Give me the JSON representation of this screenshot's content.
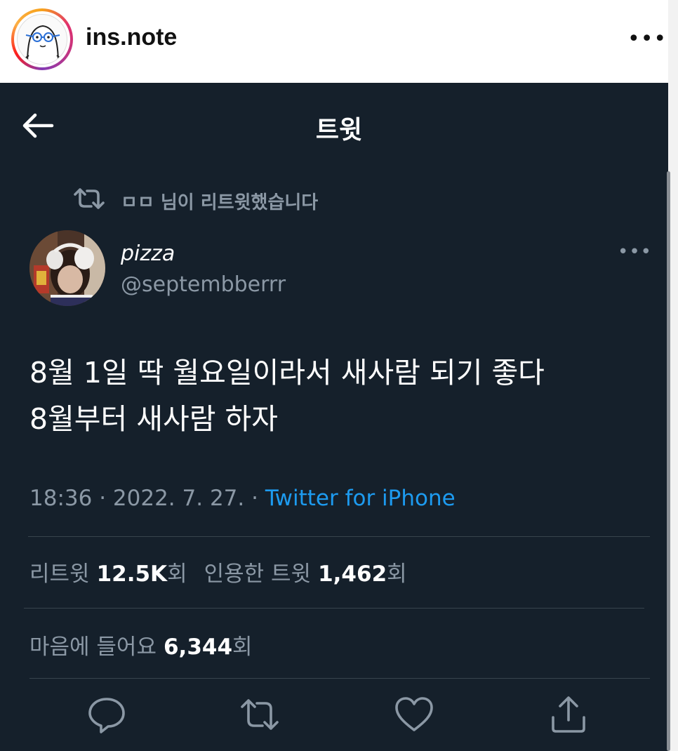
{
  "instagram_header": {
    "username": "ins.note",
    "more_label": "•••"
  },
  "twitter": {
    "page_title": "트윗",
    "retweet_notice": "ㅁㅁ 님이 리트윗했습니다",
    "author": {
      "display_name": "pizza",
      "handle": "@septembberrr"
    },
    "tweet_more_label": "•••",
    "tweet_lines": [
      "8월 1일 딱 월요일이라서 새사람 되기 좋다",
      "8월부터 새사람 하자"
    ],
    "meta": {
      "time": "18:36",
      "separator1": " · ",
      "date": "2022. 7. 27.",
      "separator2": " · ",
      "source": "Twitter for iPhone"
    },
    "stats": {
      "retweets_label": "리트윗",
      "retweets_count": "12.5K",
      "retweets_unit": "회",
      "quotes_label": "인용한 트윗",
      "quotes_count": "1,462",
      "quotes_unit": "회",
      "likes_label": "마음에 들어요",
      "likes_count": "6,344",
      "likes_unit": "회"
    },
    "actions": [
      "reply-icon",
      "retweet-icon",
      "like-icon",
      "share-icon"
    ]
  },
  "colors": {
    "background": "#15202b",
    "secondary_text": "#8b98a5",
    "link": "#1d9bf0",
    "divider": "#38444d"
  }
}
